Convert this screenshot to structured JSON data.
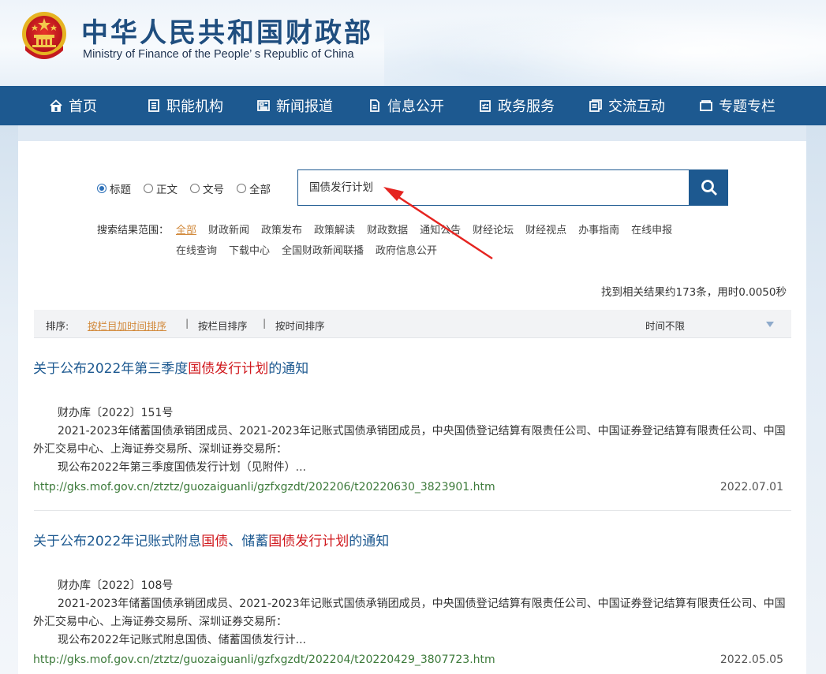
{
  "header": {
    "title": "中华人民共和国财政部",
    "subtitle": "Ministry of Finance of the People’ s Republic of China"
  },
  "nav": [
    {
      "label": "首页",
      "icon": "home-icon"
    },
    {
      "label": "职能机构",
      "icon": "list-icon"
    },
    {
      "label": "新闻报道",
      "icon": "newspaper-icon"
    },
    {
      "label": "信息公开",
      "icon": "document-icon"
    },
    {
      "label": "政务服务",
      "icon": "checklist-icon"
    },
    {
      "label": "交流互动",
      "icon": "chat-icon"
    },
    {
      "label": "专题专栏",
      "icon": "folder-icon"
    }
  ],
  "search": {
    "radio_options": [
      {
        "label": "标题",
        "checked": true
      },
      {
        "label": "正文",
        "checked": false
      },
      {
        "label": "文号",
        "checked": false
      },
      {
        "label": "全部",
        "checked": false
      }
    ],
    "query": "国债发行计划",
    "button_icon": "search-icon"
  },
  "scope": {
    "label": "搜索结果范围：",
    "items_row1": [
      "全部",
      "财政新闻",
      "政策发布",
      "政策解读",
      "财政数据",
      "通知公告",
      "财经论坛",
      "财经视点",
      "办事指南",
      "在线申报"
    ],
    "items_row2": [
      "在线查询",
      "下载中心",
      "全国财政新闻联播",
      "政府信息公开"
    ],
    "active": "全部"
  },
  "result_count": "找到相关结果约173条，用时0.0050秒",
  "sort": {
    "label": "排序:",
    "options": [
      "按栏目加时间排序",
      "按栏目排序",
      "按时间排序"
    ],
    "active": "按栏目加时间排序",
    "time_filter": "时间不限"
  },
  "results": [
    {
      "title_parts": [
        {
          "text": "关于公布2022年第三季度",
          "hl": false
        },
        {
          "text": "国债发行计划",
          "hl": true
        },
        {
          "text": "的通知",
          "hl": false
        }
      ],
      "doc_no": "财办库〔2022〕151号",
      "body": "2021-2023年储蓄国债承销团成员、2021-2023年记账式国债承销团成员，中央国债登记结算有限责任公司、中国证券登记结算有限责任公司、中国外汇交易中心、上海证券交易所、深圳证券交易所：",
      "body2": "现公布2022年第三季度国债发行计划（见附件）...",
      "url": "http://gks.mof.gov.cn/ztztz/guozaiguanli/gzfxgzdt/202206/t20220630_3823901.htm",
      "date": "2022.07.01"
    },
    {
      "title_parts": [
        {
          "text": "关于公布2022年记账式附息",
          "hl": false
        },
        {
          "text": "国债",
          "hl": true
        },
        {
          "text": "、储蓄",
          "hl": false
        },
        {
          "text": "国债发行计划",
          "hl": true
        },
        {
          "text": "的通知",
          "hl": false
        }
      ],
      "doc_no": "财办库〔2022〕108号",
      "body": "2021-2023年储蓄国债承销团成员、2021-2023年记账式国债承销团成员，中央国债登记结算有限责任公司、中国证券登记结算有限责任公司、中国外汇交易中心、上海证券交易所、深圳证券交易所：",
      "body2": "现公布2022年记账式附息国债、储蓄国债发行计...",
      "url": "http://gks.mof.gov.cn/ztztz/guozaiguanli/gzfxgzdt/202204/t20220429_3807723.htm",
      "date": "2022.05.05"
    }
  ],
  "colors": {
    "nav_bg": "#1d5990",
    "title_blue": "#1d5990",
    "highlight_red": "#d0181d",
    "url_green": "#3c7a3a",
    "active_orange": "#d28a3c",
    "annotation_arrow": "#e52420"
  }
}
